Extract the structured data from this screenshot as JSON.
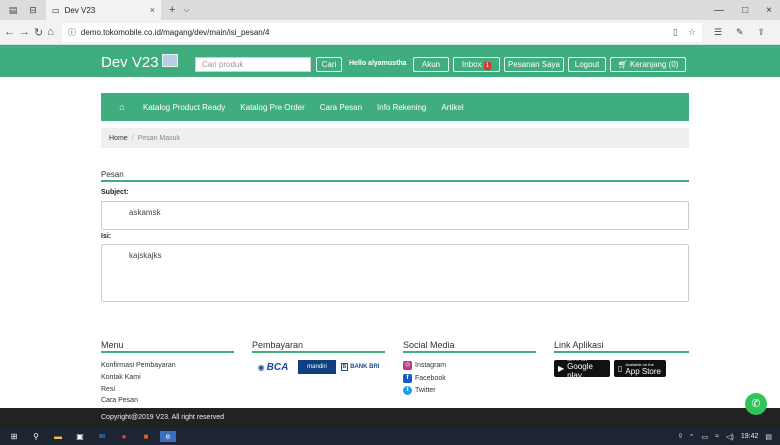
{
  "browser": {
    "tab_title": "Dev V23",
    "tab_close": "×",
    "new_tab": "+",
    "tab_dropdown": "⌵",
    "url": "demo.tokomobile.co.id/magang/dev/main/isi_pesan/4",
    "window_controls": [
      "—",
      "□",
      "×"
    ]
  },
  "header": {
    "brand": "Dev V23",
    "search_placeholder": "Cari produk",
    "search_button": "Cari",
    "greeting": "Hello alyamustha",
    "buttons": {
      "account": "Akun",
      "inbox": "Inbox",
      "inbox_count": "1",
      "orders": "Pesanan Saya",
      "logout": "Logout",
      "cart": "Keranjang (0)"
    }
  },
  "nav": {
    "home_icon": "home-icon",
    "items": [
      "Katalog Product Ready",
      "Katalog Pre Order",
      "Cara Pesan",
      "Info Rekening",
      "Artikel"
    ]
  },
  "breadcrumb": {
    "home": "Home",
    "current": "Pesan Masuk"
  },
  "message": {
    "section_title": "Pesan",
    "subject_label": "Subject:",
    "subject_value": "askamsk",
    "body_label": "Isi:",
    "body_value": "kajskajks"
  },
  "footer": {
    "menu": {
      "title": "Menu",
      "links": [
        "Konfirmasi Pembayaran",
        "Kontak Kami",
        "Resi",
        "Cara Pesan"
      ]
    },
    "payment": {
      "title": "Pembayaran",
      "banks": [
        "BCA",
        "mandiri",
        "BANK BRI"
      ]
    },
    "social": {
      "title": "Social Media",
      "links": [
        "Instagram",
        "Facebook",
        "Twitter"
      ]
    },
    "apps": {
      "title": "Link Aplikasi",
      "google_small": "GET IT ON",
      "google": "Google play",
      "apple_small": "Available on the",
      "apple": "App Store"
    },
    "copyright": "Copyright@2019 V23. All right reserved"
  },
  "taskbar": {
    "time": "19:42"
  },
  "colors": {
    "brand_green": "#40ad7f",
    "footer_dark": "#222222",
    "badge_red": "#d9342b"
  }
}
